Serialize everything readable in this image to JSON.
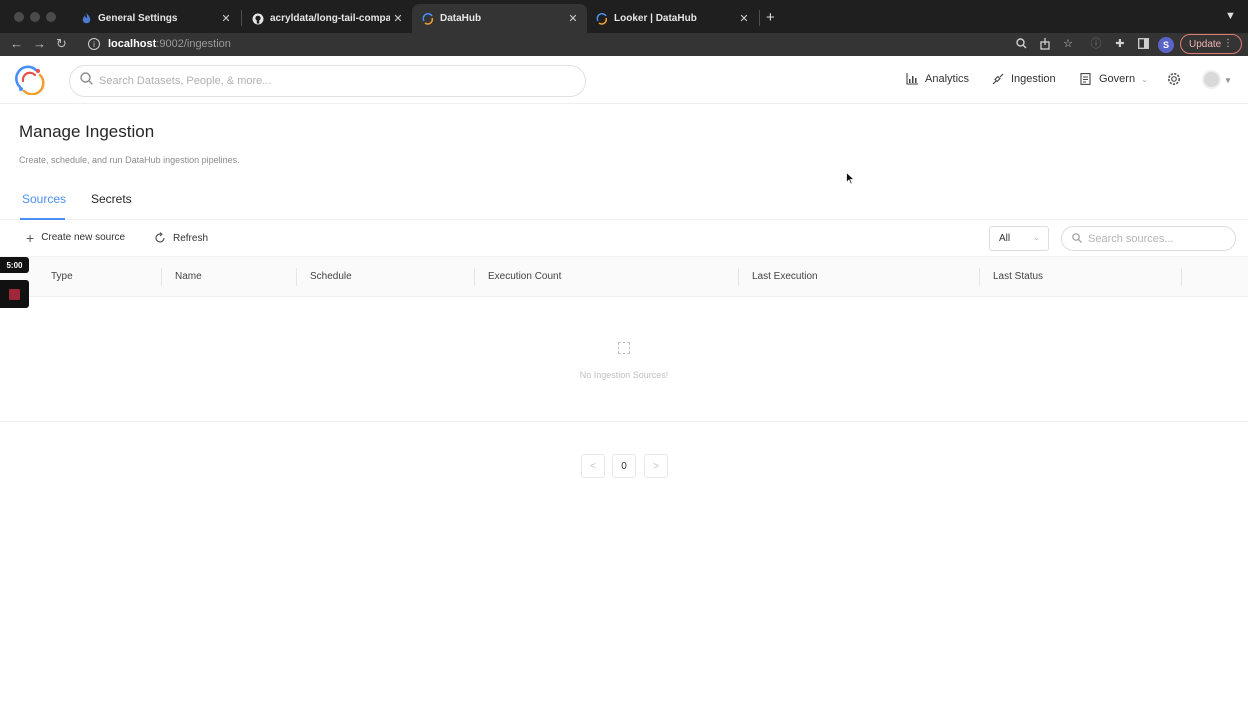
{
  "browser": {
    "tabs": [
      {
        "label": "General Settings",
        "icon": "datahub-flame-icon"
      },
      {
        "label": "acryldata/long-tail-companion",
        "icon": "github-icon"
      },
      {
        "label": "DataHub",
        "icon": "datahub-icon"
      },
      {
        "label": "Looker | DataHub",
        "icon": "datahub-icon"
      }
    ],
    "new_tab": "+",
    "url_host": "localhost",
    "url_path": ":9002/ingestion",
    "profile_initial": "S",
    "update_label": "Update"
  },
  "header": {
    "search_placeholder": "Search Datasets, People, & more...",
    "nav": {
      "analytics": "Analytics",
      "ingestion": "Ingestion",
      "govern": "Govern"
    }
  },
  "page": {
    "title": "Manage Ingestion",
    "description": "Create, schedule, and run DataHub ingestion pipelines.",
    "tabs": {
      "sources": "Sources",
      "secrets": "Secrets"
    },
    "actions": {
      "create": "Create new source",
      "refresh": "Refresh",
      "filter_value": "All",
      "search_placeholder": "Search sources..."
    },
    "table": {
      "columns": [
        "Type",
        "Name",
        "Schedule",
        "Execution Count",
        "Last Execution",
        "Last Status"
      ],
      "empty_text": "No Ingestion Sources!"
    },
    "pagination": {
      "prev": "<",
      "page": "0",
      "next": ">"
    }
  },
  "overlay": {
    "timer": "5:00"
  },
  "colors": {
    "accent": "#4a8ff5",
    "update_border": "#e07b74",
    "record": "#a0263a"
  }
}
